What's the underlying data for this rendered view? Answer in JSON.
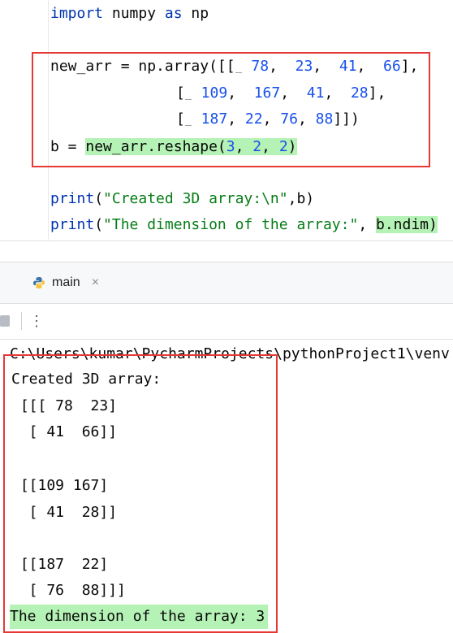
{
  "editor": {
    "line1": {
      "kw_import": "import",
      "mid": " numpy ",
      "kw_as": "as",
      "alias": " np"
    },
    "line2": {
      "p1": "new_arr = np.array([[",
      "n1": " 78",
      "c1": ",  ",
      "n2": "23",
      "c2": ",  ",
      "n3": "41",
      "c3": ",  ",
      "n4": "66",
      "end": "],"
    },
    "line3": {
      "p1": "[",
      "n1": " 109",
      "c1": ",  ",
      "n2": "167",
      "c2": ",  ",
      "n3": "41",
      "c3": ",  ",
      "n4": "28",
      "end": "],"
    },
    "line4": {
      "p1": "[",
      "n1": " 187",
      "c1": ", ",
      "n2": "22",
      "c2": ", ",
      "n3": "76",
      "c3": ", ",
      "n4": "88",
      "end": "]])"
    },
    "line5": {
      "p1": "b = ",
      "hl_a": "new_arr.reshape(",
      "hn1": "3",
      "hc1": ", ",
      "hn2": "2",
      "hc2": ", ",
      "hn3": "2",
      "hl_b": ")"
    },
    "line6": {
      "fn": "print",
      "open": "(",
      "str": "\"Created 3D array:\\n\"",
      "rest": ",b)"
    },
    "line7": {
      "fn": "print",
      "open": "(",
      "str": "\"The dimension of the array:\"",
      "comma": ", ",
      "hl": "b.ndim)"
    }
  },
  "run_panel": {
    "tab_label": "main",
    "close_glyph": "×",
    "more_glyph": "⋮"
  },
  "console": {
    "path": "C:\\Users\\kumar\\PycharmProjects\\pythonProject1\\venv",
    "lines": [
      "Created 3D array:",
      " [[[ 78  23]",
      "  [ 41  66]]",
      "",
      " [[109 167]",
      "  [ 41  28]]",
      "",
      " [[187  22]",
      "  [ 76  88]]]"
    ],
    "result_line": "The dimension of the array: 3"
  },
  "colors": {
    "keyword": "#0033b3",
    "number": "#1750eb",
    "string": "#067d17",
    "highlight": "#b5f2b5",
    "annotation_box": "#e53935"
  }
}
